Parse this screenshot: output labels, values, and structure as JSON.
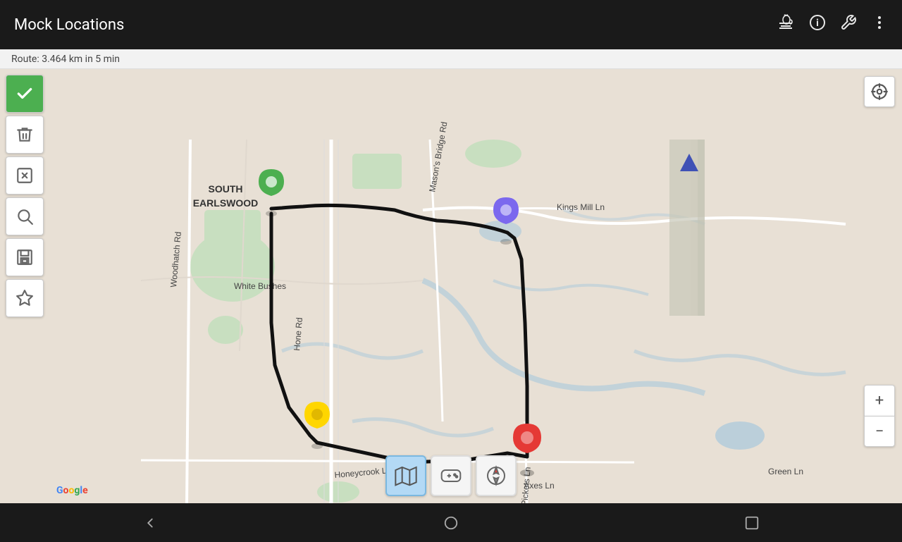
{
  "app": {
    "title": "Mock Locations"
  },
  "topbar": {
    "icons": [
      "coffee-icon",
      "info-icon",
      "wrench-icon",
      "more-icon"
    ]
  },
  "route_info": {
    "text": "Route: 3.464 km in 5 min"
  },
  "toolbar": {
    "buttons": [
      {
        "id": "check",
        "label": "Confirm",
        "active": true
      },
      {
        "id": "trash",
        "label": "Delete"
      },
      {
        "id": "clear",
        "label": "Clear"
      },
      {
        "id": "search",
        "label": "Search"
      },
      {
        "id": "save",
        "label": "Save"
      },
      {
        "id": "star",
        "label": "Favorites"
      }
    ]
  },
  "map": {
    "zoom_plus": "+",
    "zoom_minus": "−"
  },
  "bottom_toolbar": {
    "buttons": [
      {
        "id": "map-mode",
        "label": "Map",
        "selected": true
      },
      {
        "id": "game-mode",
        "label": "Game"
      },
      {
        "id": "compass-mode",
        "label": "Compass"
      }
    ]
  },
  "nav_bar": {
    "back": "◁",
    "home": "○",
    "recent": "□"
  },
  "google_logo": "Google"
}
